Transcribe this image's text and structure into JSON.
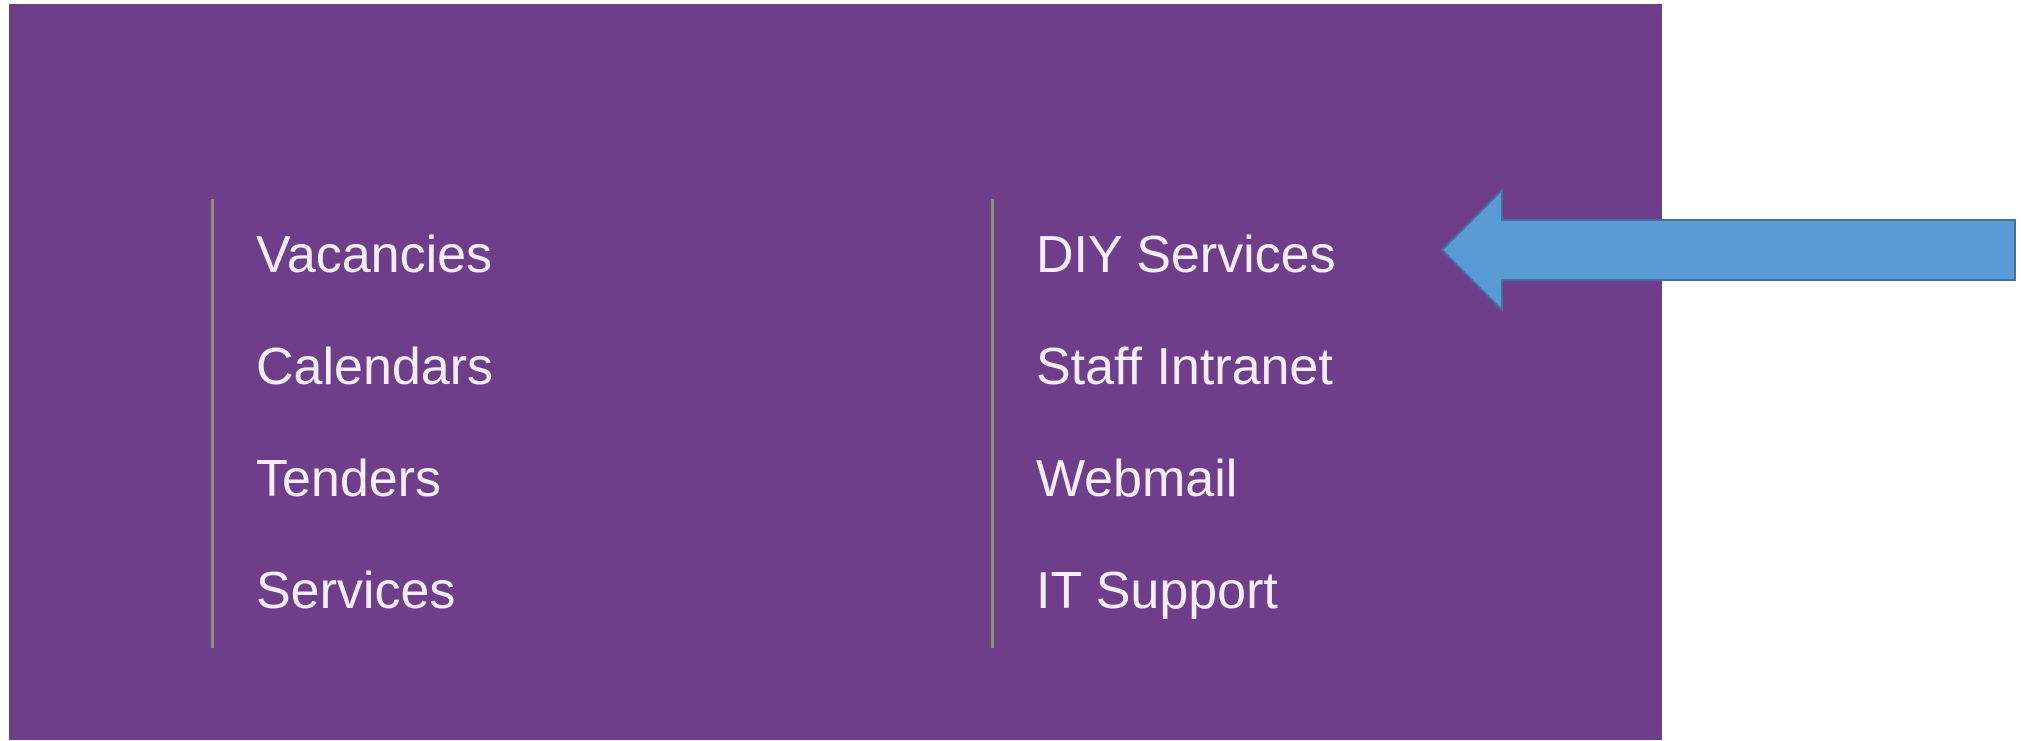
{
  "menu": {
    "left_column": [
      {
        "label": "Vacancies"
      },
      {
        "label": "Calendars"
      },
      {
        "label": "Tenders"
      },
      {
        "label": "Services"
      }
    ],
    "right_column": [
      {
        "label": "DIY Services"
      },
      {
        "label": "Staff Intranet"
      },
      {
        "label": "Webmail"
      },
      {
        "label": "IT Support"
      }
    ]
  },
  "colors": {
    "panel_background": "#6e3e8b",
    "link_text": "#f5eefa",
    "divider": "#8a9070",
    "arrow_fill": "#5b9bd5",
    "arrow_stroke": "#41719c"
  },
  "annotation": {
    "arrow_icon": "left-arrow-icon",
    "points_to": "DIY Services"
  }
}
